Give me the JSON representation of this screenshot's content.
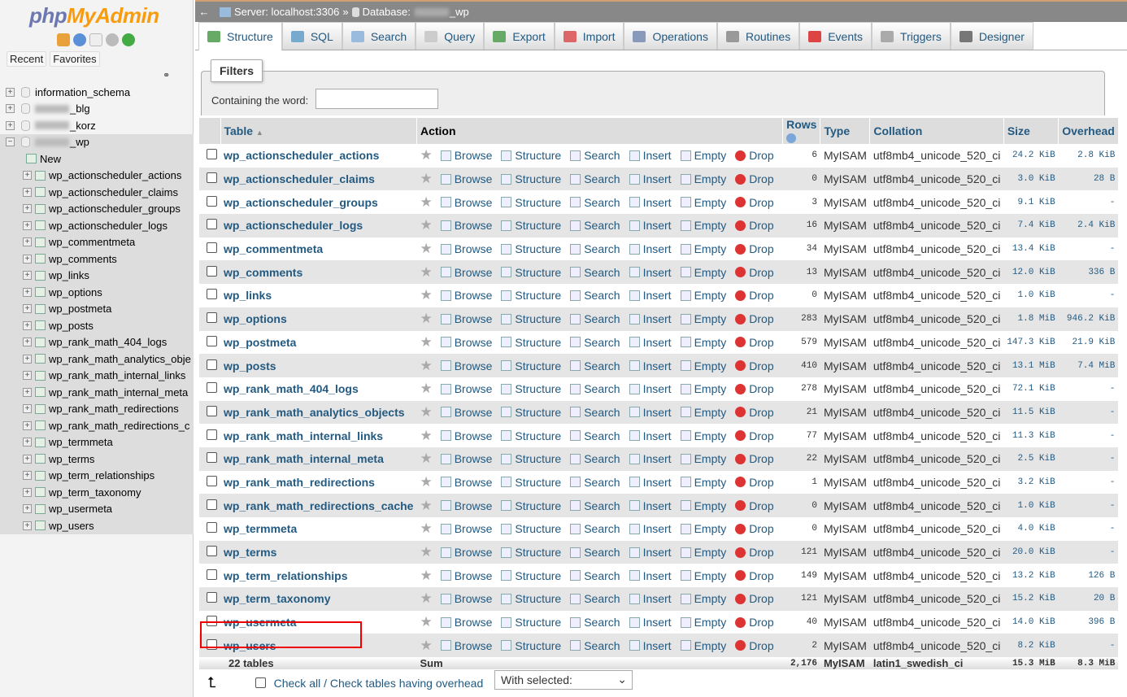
{
  "sidebar": {
    "logo": "phpMyAdmin",
    "tabs": [
      "Recent",
      "Favorites"
    ],
    "databases": [
      {
        "name": "information_schema",
        "blurred": false
      },
      {
        "name": "_blg",
        "blurred": true
      },
      {
        "name": "_korz",
        "blurred": true
      },
      {
        "name": "_wp",
        "blurred": true,
        "expanded": true
      }
    ],
    "new_label": "New",
    "tables": [
      "wp_actionscheduler_actions",
      "wp_actionscheduler_claims",
      "wp_actionscheduler_groups",
      "wp_actionscheduler_logs",
      "wp_commentmeta",
      "wp_comments",
      "wp_links",
      "wp_options",
      "wp_postmeta",
      "wp_posts",
      "wp_rank_math_404_logs",
      "wp_rank_math_analytics_obje",
      "wp_rank_math_internal_links",
      "wp_rank_math_internal_meta",
      "wp_rank_math_redirections",
      "wp_rank_math_redirections_c",
      "wp_termmeta",
      "wp_terms",
      "wp_term_relationships",
      "wp_term_taxonomy",
      "wp_usermeta",
      "wp_users"
    ]
  },
  "breadcrumb": {
    "server": "Server: localhost:3306",
    "sep": "»",
    "database_label": "Database:",
    "database": "_wp"
  },
  "tabs": [
    {
      "label": "Structure",
      "icon": "structure-icon",
      "color": "#6a6"
    },
    {
      "label": "SQL",
      "icon": "sql-icon",
      "color": "#7ac"
    },
    {
      "label": "Search",
      "icon": "search-icon",
      "color": "#9bd"
    },
    {
      "label": "Query",
      "icon": "query-icon",
      "color": "#ccc"
    },
    {
      "label": "Export",
      "icon": "export-icon",
      "color": "#6a6"
    },
    {
      "label": "Import",
      "icon": "import-icon",
      "color": "#d66"
    },
    {
      "label": "Operations",
      "icon": "wrench-icon",
      "color": "#89b"
    },
    {
      "label": "Routines",
      "icon": "routines-icon",
      "color": "#999"
    },
    {
      "label": "Events",
      "icon": "clock-icon",
      "color": "#d44"
    },
    {
      "label": "Triggers",
      "icon": "triggers-icon",
      "color": "#aaa"
    },
    {
      "label": "Designer",
      "icon": "designer-icon",
      "color": "#777"
    }
  ],
  "filters": {
    "legend": "Filters",
    "label": "Containing the word:",
    "value": ""
  },
  "table": {
    "headers": {
      "table": "Table",
      "action": "Action",
      "rows": "Rows",
      "type": "Type",
      "collation": "Collation",
      "size": "Size",
      "overhead": "Overhead"
    },
    "actions": [
      "Browse",
      "Structure",
      "Search",
      "Insert",
      "Empty",
      "Drop"
    ],
    "rows": [
      {
        "name": "wp_actionscheduler_actions",
        "rows": "6",
        "type": "MyISAM",
        "collation": "utf8mb4_unicode_520_ci",
        "size": "24.2 KiB",
        "overhead": "2.8 KiB"
      },
      {
        "name": "wp_actionscheduler_claims",
        "rows": "0",
        "type": "MyISAM",
        "collation": "utf8mb4_unicode_520_ci",
        "size": "3.0 KiB",
        "overhead": "28 B"
      },
      {
        "name": "wp_actionscheduler_groups",
        "rows": "3",
        "type": "MyISAM",
        "collation": "utf8mb4_unicode_520_ci",
        "size": "9.1 KiB",
        "overhead": "-"
      },
      {
        "name": "wp_actionscheduler_logs",
        "rows": "16",
        "type": "MyISAM",
        "collation": "utf8mb4_unicode_520_ci",
        "size": "7.4 KiB",
        "overhead": "2.4 KiB"
      },
      {
        "name": "wp_commentmeta",
        "rows": "34",
        "type": "MyISAM",
        "collation": "utf8mb4_unicode_520_ci",
        "size": "13.4 KiB",
        "overhead": "-"
      },
      {
        "name": "wp_comments",
        "rows": "13",
        "type": "MyISAM",
        "collation": "utf8mb4_unicode_520_ci",
        "size": "12.0 KiB",
        "overhead": "336 B"
      },
      {
        "name": "wp_links",
        "rows": "0",
        "type": "MyISAM",
        "collation": "utf8mb4_unicode_520_ci",
        "size": "1.0 KiB",
        "overhead": "-"
      },
      {
        "name": "wp_options",
        "rows": "283",
        "type": "MyISAM",
        "collation": "utf8mb4_unicode_520_ci",
        "size": "1.8 MiB",
        "overhead": "946.2 KiB"
      },
      {
        "name": "wp_postmeta",
        "rows": "579",
        "type": "MyISAM",
        "collation": "utf8mb4_unicode_520_ci",
        "size": "147.3 KiB",
        "overhead": "21.9 KiB"
      },
      {
        "name": "wp_posts",
        "rows": "410",
        "type": "MyISAM",
        "collation": "utf8mb4_unicode_520_ci",
        "size": "13.1 MiB",
        "overhead": "7.4 MiB"
      },
      {
        "name": "wp_rank_math_404_logs",
        "rows": "278",
        "type": "MyISAM",
        "collation": "utf8mb4_unicode_520_ci",
        "size": "72.1 KiB",
        "overhead": "-"
      },
      {
        "name": "wp_rank_math_analytics_objects",
        "rows": "21",
        "type": "MyISAM",
        "collation": "utf8mb4_unicode_520_ci",
        "size": "11.5 KiB",
        "overhead": "-"
      },
      {
        "name": "wp_rank_math_internal_links",
        "rows": "77",
        "type": "MyISAM",
        "collation": "utf8mb4_unicode_520_ci",
        "size": "11.3 KiB",
        "overhead": "-"
      },
      {
        "name": "wp_rank_math_internal_meta",
        "rows": "22",
        "type": "MyISAM",
        "collation": "utf8mb4_unicode_520_ci",
        "size": "2.5 KiB",
        "overhead": "-"
      },
      {
        "name": "wp_rank_math_redirections",
        "rows": "1",
        "type": "MyISAM",
        "collation": "utf8mb4_unicode_520_ci",
        "size": "3.2 KiB",
        "overhead": "-"
      },
      {
        "name": "wp_rank_math_redirections_cache",
        "rows": "0",
        "type": "MyISAM",
        "collation": "utf8mb4_unicode_520_ci",
        "size": "1.0 KiB",
        "overhead": "-"
      },
      {
        "name": "wp_termmeta",
        "rows": "0",
        "type": "MyISAM",
        "collation": "utf8mb4_unicode_520_ci",
        "size": "4.0 KiB",
        "overhead": "-"
      },
      {
        "name": "wp_terms",
        "rows": "121",
        "type": "MyISAM",
        "collation": "utf8mb4_unicode_520_ci",
        "size": "20.0 KiB",
        "overhead": "-"
      },
      {
        "name": "wp_term_relationships",
        "rows": "149",
        "type": "MyISAM",
        "collation": "utf8mb4_unicode_520_ci",
        "size": "13.2 KiB",
        "overhead": "126 B"
      },
      {
        "name": "wp_term_taxonomy",
        "rows": "121",
        "type": "MyISAM",
        "collation": "utf8mb4_unicode_520_ci",
        "size": "15.2 KiB",
        "overhead": "20 B"
      },
      {
        "name": "wp_usermeta",
        "rows": "40",
        "type": "MyISAM",
        "collation": "utf8mb4_unicode_520_ci",
        "size": "14.0 KiB",
        "overhead": "396 B"
      },
      {
        "name": "wp_users",
        "rows": "2",
        "type": "MyISAM",
        "collation": "utf8mb4_unicode_520_ci",
        "size": "8.2 KiB",
        "overhead": "-",
        "highlighted": true
      }
    ],
    "summary": {
      "count": "22 tables",
      "label": "Sum",
      "rows": "2,176",
      "type": "MyISAM",
      "collation": "latin1_swedish_ci",
      "size": "15.3 MiB",
      "overhead": "8.3 MiB"
    }
  },
  "footer": {
    "check_all": "Check all",
    "sep": " / ",
    "check_overhead": "Check tables having overhead",
    "with_selected": "With selected:"
  },
  "colors": {
    "link": "#235a81",
    "highlight_box": "#e00000"
  }
}
